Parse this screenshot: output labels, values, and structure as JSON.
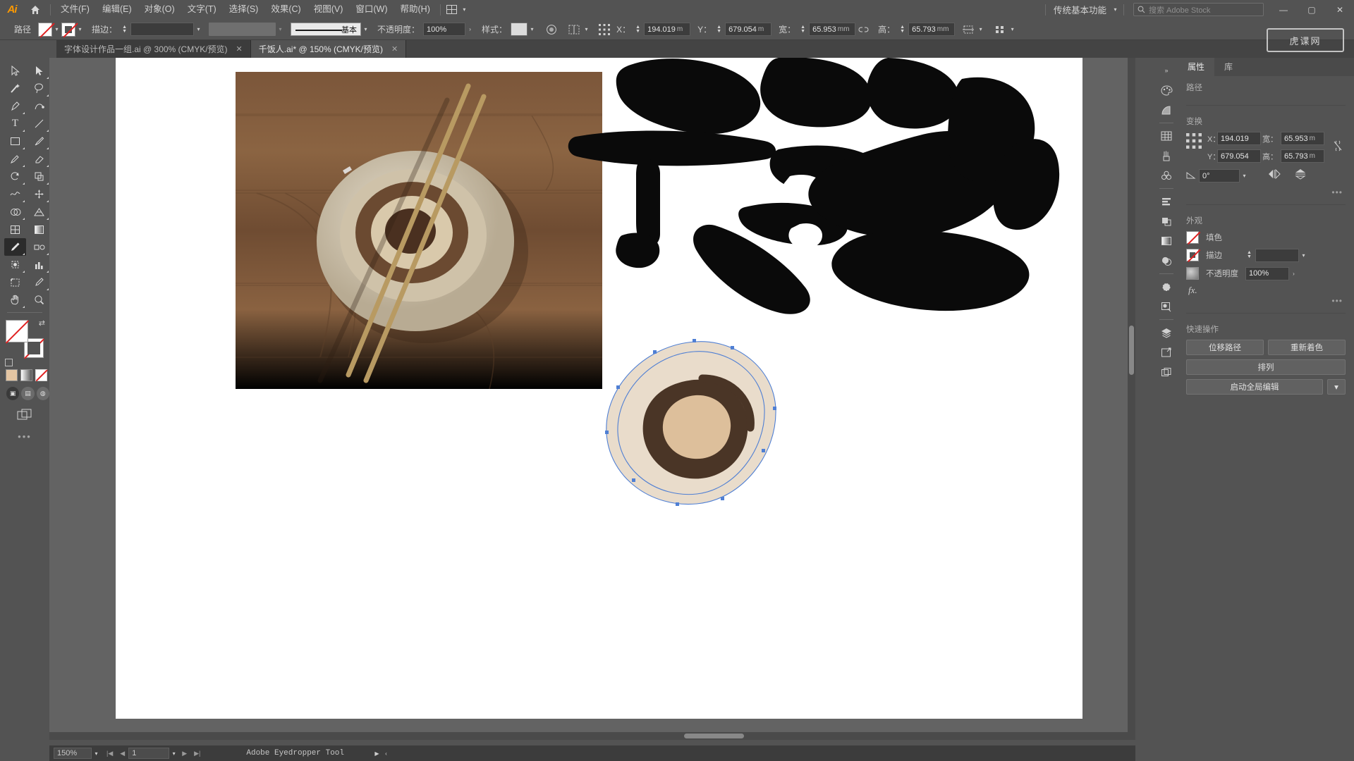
{
  "app": {
    "name": "Adobe Illustrator",
    "logo_text": "Ai"
  },
  "menubar": {
    "items": [
      {
        "label": "文件(F)"
      },
      {
        "label": "编辑(E)"
      },
      {
        "label": "对象(O)"
      },
      {
        "label": "文字(T)"
      },
      {
        "label": "选择(S)"
      },
      {
        "label": "效果(C)"
      },
      {
        "label": "视图(V)"
      },
      {
        "label": "窗口(W)"
      },
      {
        "label": "帮助(H)"
      }
    ],
    "workspace": "传统基本功能",
    "search_placeholder": "搜索 Adobe Stock",
    "window_minimize": "—",
    "window_maximize": "▢",
    "window_close": "✕"
  },
  "controlbar": {
    "context_label": "路径",
    "stroke_label": "描边：",
    "stroke_weight": "",
    "stroke_profile_label": "基本",
    "opacity_label": "不透明度：",
    "opacity_value": "100%",
    "style_label": "样式：",
    "x_label": "X：",
    "x_value": "194.019",
    "x_unit": "m",
    "y_label": "Y：",
    "y_value": "679.054",
    "y_unit": "m",
    "w_label": "宽：",
    "w_value": "65.953",
    "w_unit": "mm",
    "h_label": "高：",
    "h_value": "65.793",
    "h_unit": "mm"
  },
  "tabs": [
    {
      "title": "字体设计作品一组.ai @ 300% (CMYK/预览)",
      "active": false,
      "close": "✕"
    },
    {
      "title": "千饭人.ai* @ 150% (CMYK/预览)",
      "active": true,
      "close": "✕"
    }
  ],
  "toolbar": {
    "tools": [
      {
        "name": "selection-tool",
        "glyph": "⬈"
      },
      {
        "name": "direct-selection-tool",
        "glyph": "⬈"
      },
      {
        "name": "magic-wand-tool",
        "glyph": "✦"
      },
      {
        "name": "lasso-tool",
        "glyph": "◌"
      },
      {
        "name": "pen-tool",
        "glyph": "✒"
      },
      {
        "name": "curvature-tool",
        "glyph": "ᗒ"
      },
      {
        "name": "type-tool",
        "glyph": "T"
      },
      {
        "name": "line-segment-tool",
        "glyph": "╱"
      },
      {
        "name": "rectangle-tool",
        "glyph": "▭"
      },
      {
        "name": "paintbrush-tool",
        "glyph": "🖌"
      },
      {
        "name": "shaper-pencil-tool",
        "glyph": "✎"
      },
      {
        "name": "eraser-tool",
        "glyph": "◇"
      },
      {
        "name": "rotate-tool",
        "glyph": "↻"
      },
      {
        "name": "scale-tool",
        "glyph": "⬘"
      },
      {
        "name": "width-warp-tool",
        "glyph": "∿"
      },
      {
        "name": "free-transform-tool",
        "glyph": "✥"
      },
      {
        "name": "shape-builder-tool",
        "glyph": "◕"
      },
      {
        "name": "perspective-grid-tool",
        "glyph": "▦"
      },
      {
        "name": "mesh-tool",
        "glyph": "▩"
      },
      {
        "name": "gradient-tool",
        "glyph": "▤"
      },
      {
        "name": "eyedropper-tool",
        "glyph": "⚲",
        "selected": true
      },
      {
        "name": "blend-tool",
        "glyph": "⊙"
      },
      {
        "name": "symbol-sprayer-tool",
        "glyph": "⊡"
      },
      {
        "name": "column-graph-tool",
        "glyph": "▥"
      },
      {
        "name": "artboard-tool",
        "glyph": "⊞"
      },
      {
        "name": "slice-tool",
        "glyph": "✂"
      },
      {
        "name": "hand-tool",
        "glyph": "✋"
      },
      {
        "name": "zoom-tool",
        "glyph": "🔍"
      }
    ],
    "fill_name": "fill-swatch-none",
    "stroke_name": "stroke-swatch-none",
    "color_modes": [
      {
        "name": "color-mode-color",
        "glyph": ""
      },
      {
        "name": "color-mode-gradient",
        "glyph": ""
      },
      {
        "name": "color-mode-none",
        "glyph": ""
      }
    ],
    "draw_modes": [
      {
        "name": "draw-normal",
        "glyph": "▣",
        "on": true
      },
      {
        "name": "draw-behind",
        "glyph": "▤",
        "on": false
      },
      {
        "name": "draw-inside",
        "glyph": "◍",
        "on": false
      }
    ],
    "screen_mode": "⧉",
    "overflow": "•••"
  },
  "canvas": {
    "photo_alt": "wooden table with rice bowl and chopsticks photo",
    "calligraphy_alt": "black brush calligraphy characters",
    "bowl_vector_alt": "vector bowl illustration with selected path anchors",
    "colors": {
      "bowl_bg": "#e9dccb",
      "bowl_ring_dark": "#4a3526",
      "bowl_center": "#ddbf9b",
      "selection_blue": "#4f7fd4"
    }
  },
  "rail": {
    "icons": [
      {
        "name": "color-panel-icon",
        "glyph": "◕"
      },
      {
        "name": "color-guide-icon",
        "glyph": "◑"
      },
      {
        "name": "swatches-panel-icon",
        "glyph": "▦"
      },
      {
        "name": "brushes-panel-icon",
        "glyph": "🖌"
      },
      {
        "name": "symbols-panel-icon",
        "glyph": "✿"
      },
      {
        "name": "align-panel-icon",
        "glyph": "≡"
      },
      {
        "name": "pathfinder-panel-icon",
        "glyph": "▣"
      },
      {
        "name": "gradient-panel-icon",
        "glyph": "▤"
      },
      {
        "name": "transparency-icon",
        "glyph": "◎"
      },
      {
        "name": "appearance-panel-icon",
        "glyph": "●"
      },
      {
        "name": "graphic-styles-icon",
        "glyph": "◪"
      },
      {
        "name": "layers-panel-icon",
        "glyph": "◈"
      },
      {
        "name": "artboards-panel-icon",
        "glyph": "⬈"
      },
      {
        "name": "asset-export-icon",
        "glyph": "⧉"
      }
    ]
  },
  "properties": {
    "tabs": [
      {
        "label": "属性",
        "active": true
      },
      {
        "label": "库",
        "active": false
      }
    ],
    "object_type_heading": "路径",
    "transform": {
      "heading": "变换",
      "x_label": "X：",
      "x_value": "194.019",
      "y_label": "Y：",
      "y_value": "679.054",
      "w_label": "宽：",
      "w_value": "65.953",
      "w_unit": "m",
      "h_label": "高：",
      "h_value": "65.793",
      "h_unit": "m",
      "angle_value": "0°",
      "link_icon": "link-broken-icon",
      "flip_h_icon": "flip-horizontal-icon",
      "flip_v_icon": "flip-vertical-icon",
      "more_options": "•••"
    },
    "appearance": {
      "heading": "外观",
      "fill_label": "填色",
      "stroke_label": "描边",
      "stroke_weight": "",
      "opacity_label": "不透明度",
      "opacity_value": "100%",
      "fx_label": "fx.",
      "more_options": "•••"
    },
    "quick_actions": {
      "heading": "快速操作",
      "buttons": [
        {
          "label": "位移路径"
        },
        {
          "label": "重新着色"
        },
        {
          "label": "排列"
        },
        {
          "label": "启动全局编辑",
          "has_caret": true
        }
      ]
    }
  },
  "statusbar": {
    "zoom_value": "150%",
    "page_value": "1",
    "tool_name": "Adobe Eyedropper Tool",
    "nav_first": "|◀",
    "nav_prev": "◀",
    "nav_next": "▶",
    "nav_last": "▶|"
  },
  "watermark": {
    "text": "虎课网"
  }
}
